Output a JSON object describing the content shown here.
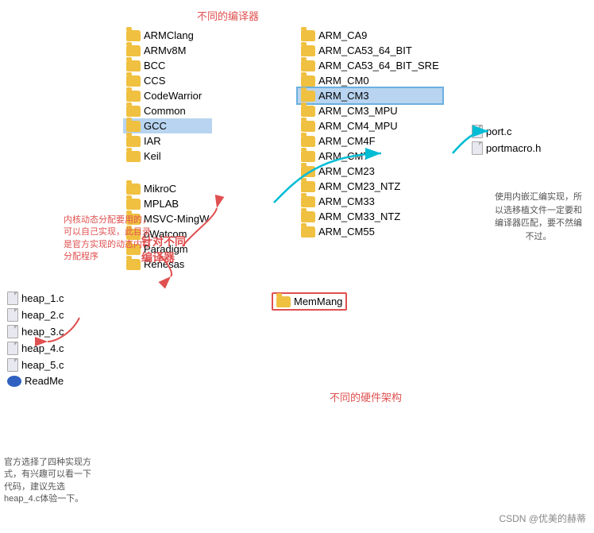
{
  "title_compilers": "不同的编译器",
  "title_hardware": "不同的硬件架构",
  "watermark": "CSDN @优美的赫蒂",
  "compilers": [
    "ARMClang",
    "ARMv8M",
    "BCC",
    "CCS",
    "CodeWarrior",
    "Common",
    "GCC",
    "IAR",
    "Keil",
    "MemMang",
    "MikroC",
    "MPLAB",
    "MSVC-MingW",
    "oWatcom",
    "Paradigm",
    "Renesas"
  ],
  "architectures": [
    "ARM_CA9",
    "ARM_CA53_64_BIT",
    "ARM_CA53_64_BIT_SRE",
    "ARM_CM0",
    "ARM_CM3",
    "ARM_CM3_MPU",
    "ARM_CM4_MPU",
    "ARM_CM4F",
    "ARM_CM7",
    "ARM_CM23",
    "ARM_CM23_NTZ",
    "ARM_CM33",
    "ARM_CM33_NTZ",
    "ARM_CM55"
  ],
  "files": [
    "port.c",
    "portmacro.h"
  ],
  "heap_files": [
    "heap_1.c",
    "heap_2.c",
    "heap_3.c",
    "heap_4.c",
    "heap_5.c",
    "ReadMe"
  ],
  "annotation_left": "内核动态分配要用的，可以自己实现，此目录是官方实现的动态内存分配程序",
  "annotation_compiler_line1": "针对不同",
  "annotation_compiler_line2": "编译器",
  "annotation_right": "使用内嵌汇编实现，所以选移植文件一定要和编译器匹配，要不然编不过。",
  "annotation_bottom": "官方选择了四种实现方式，有兴趣可以看一下代码，建议先选heap_4.c体验一下。",
  "selected_compiler": "GCC",
  "selected_arch": "ARM_CM3",
  "highlighted_memmang": "MemMang"
}
